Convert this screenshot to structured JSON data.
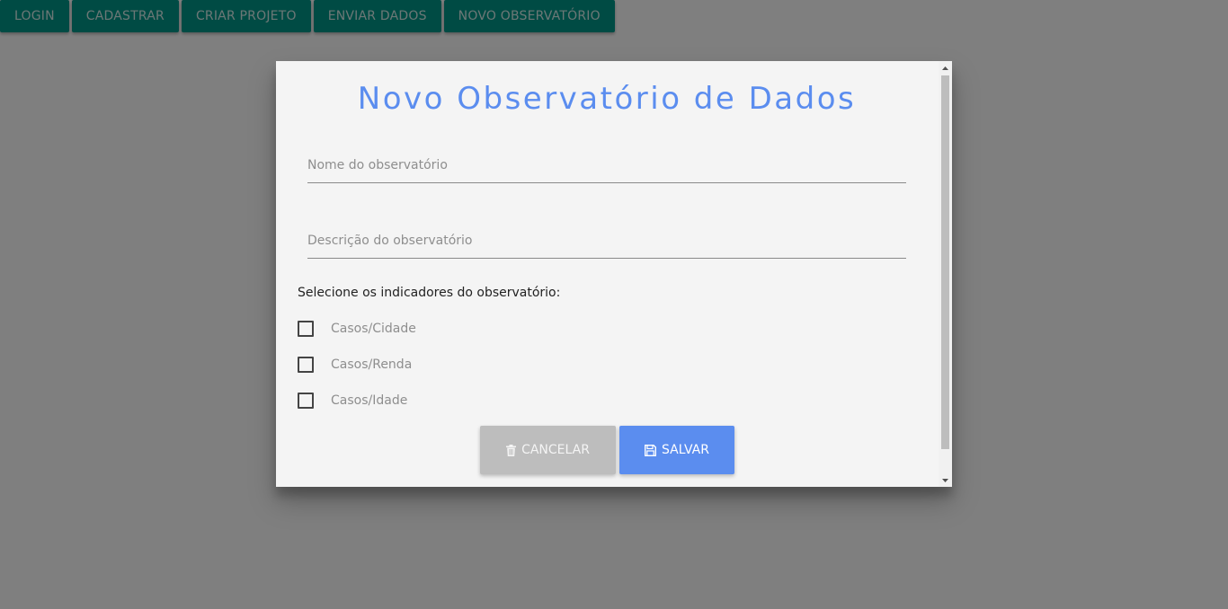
{
  "nav": {
    "items": [
      {
        "label": "LOGIN"
      },
      {
        "label": "CADASTRAR"
      },
      {
        "label": "CRIAR PROJETO"
      },
      {
        "label": "ENVIAR DADOS"
      },
      {
        "label": "NOVO OBSERVATÓRIO"
      }
    ]
  },
  "modal": {
    "title": "Novo Observatório de Dados",
    "name_placeholder": "Nome do observatório",
    "name_value": "",
    "desc_placeholder": "Descrição do observatório",
    "desc_value": "",
    "indicators_label": "Selecione os indicadores do observatório:",
    "indicators": [
      {
        "label": "Casos/Cidade",
        "checked": false
      },
      {
        "label": "Casos/Renda",
        "checked": false
      },
      {
        "label": "Casos/Idade",
        "checked": false
      }
    ],
    "cancel_label": "CANCELAR",
    "cancel_icon": "trash-icon",
    "save_label": "SALVAR",
    "save_icon": "floppy-disk-icon"
  },
  "colors": {
    "nav_bg": "#009688",
    "accent": "#5b8def",
    "cancel_bg": "#bdbdbd"
  }
}
